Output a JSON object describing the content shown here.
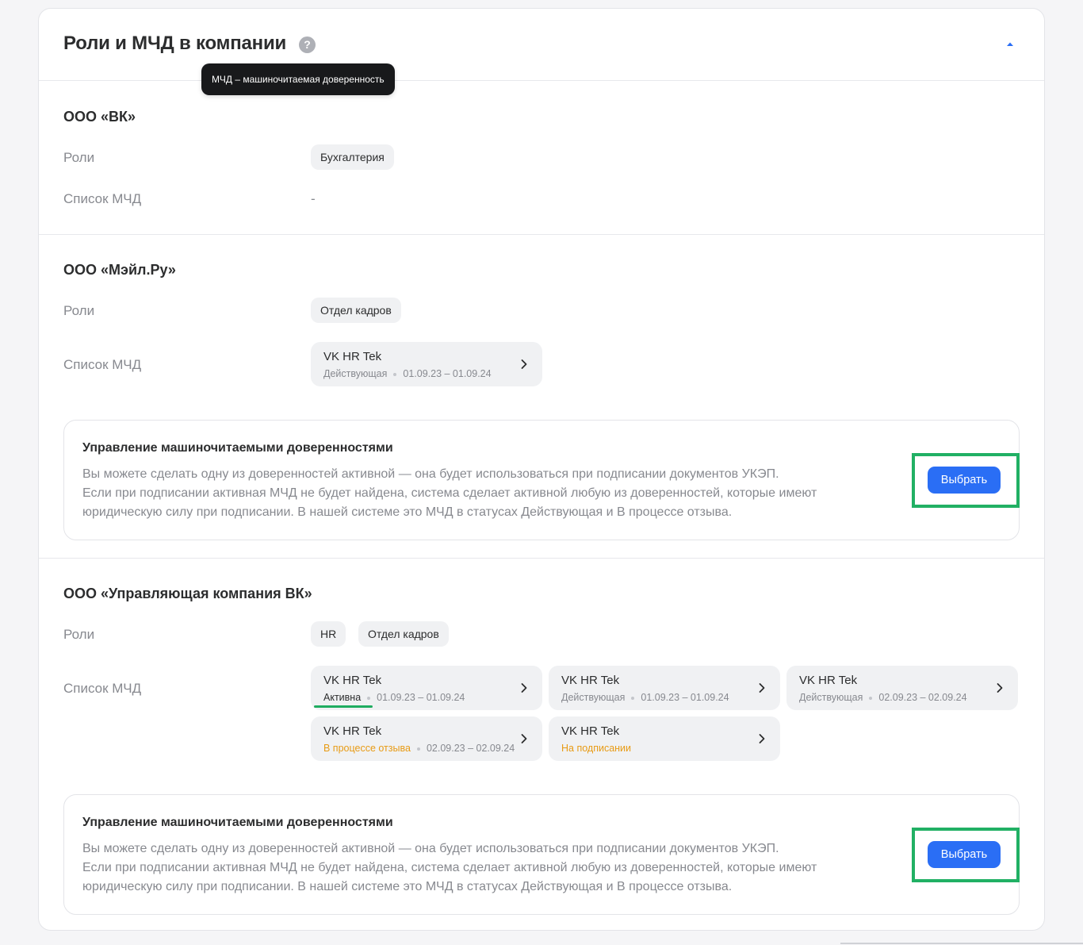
{
  "header": {
    "title": "Роли и МЧД в компании",
    "help_icon": "question-circle-icon",
    "tooltip": "МЧД – машиночитаемая доверенность",
    "collapse_icon": "caret-up-icon"
  },
  "colors": {
    "accent": "#2a6ef5",
    "highlight": "#21b064",
    "warning": "#e89b14"
  },
  "labels": {
    "roles": "Роли",
    "mcd_list": "Список МЧД"
  },
  "companies": [
    {
      "name": "ООО «ВК»",
      "roles": [
        "Бухгалтерия"
      ],
      "mcd_empty": "-"
    },
    {
      "name": "ООО «Мэйл.Ру»",
      "roles": [
        "Отдел кадров"
      ],
      "mcds": [
        {
          "title": "VK HR Tek",
          "status": "Действующая",
          "period": "01.09.23 – 01.09.24"
        }
      ],
      "manage": {
        "title": "Управление машиночитаемыми доверенностями",
        "lines": [
          "Вы можете сделать одну из доверенностей активной — она будет использоваться при подписании документов УКЭП.",
          "Если при подписании активная МЧД не будет найдена, система сделает активной любую из доверенностей, которые имеют юридическую силу при подписании. В нашей системе это МЧД в статусах Действующая и В процессе отзыва."
        ],
        "button": "Выбрать"
      }
    },
    {
      "name": "ООО «Управляющая компания ВК»",
      "roles": [
        "HR",
        "Отдел кадров"
      ],
      "mcds": [
        {
          "title": "VK HR Tek",
          "status": "Активна",
          "period": "01.09.23 – 01.09.24"
        },
        {
          "title": "VK HR Tek",
          "status": "Действующая",
          "period": "01.09.23 – 01.09.24"
        },
        {
          "title": "VK HR Tek",
          "status": "Действующая",
          "period": "02.09.23 – 02.09.24"
        },
        {
          "title": "VK HR Tek",
          "status": "В процессе отзыва",
          "period": "02.09.23 – 02.09.24"
        },
        {
          "title": "VK HR Tek",
          "status": "На подписании",
          "period": ""
        }
      ],
      "manage": {
        "title": "Управление машиночитаемыми доверенностями",
        "lines": [
          "Вы можете сделать одну из доверенностей активной — она будет использоваться при подписании документов УКЭП.",
          "Если при подписании активная МЧД не будет найдена, система сделает активной любую из доверенностей, которые имеют юридическую силу при подписании. В нашей системе это МЧД в статусах Действующая и В процессе отзыва."
        ],
        "button": "Выбрать"
      }
    }
  ]
}
